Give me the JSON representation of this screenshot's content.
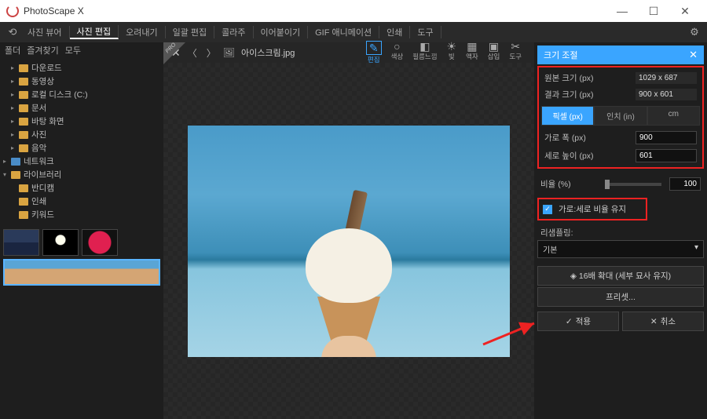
{
  "app": {
    "title": "PhotoScape X"
  },
  "window": {
    "min": "—",
    "max": "☐",
    "close": "✕"
  },
  "toolbar": {
    "items": [
      "사진 뷰어",
      "사진 편집",
      "오려내기",
      "일괄 편집",
      "콜라주",
      "이어붙이기",
      "GIF 애니메이션",
      "인쇄",
      "도구"
    ],
    "active_index": 1
  },
  "sidebar": {
    "tabs": [
      "폴더",
      "즐겨찾기",
      "모두"
    ],
    "tree": [
      {
        "label": "다운로드",
        "level": 1,
        "arrow": "▸",
        "color": "yellow"
      },
      {
        "label": "동영상",
        "level": 1,
        "arrow": "▸",
        "color": "yellow"
      },
      {
        "label": "로컬 디스크 (C:)",
        "level": 1,
        "arrow": "▸",
        "color": "yellow"
      },
      {
        "label": "문서",
        "level": 1,
        "arrow": "▸",
        "color": "yellow"
      },
      {
        "label": "바탕 화면",
        "level": 1,
        "arrow": "▸",
        "color": "yellow"
      },
      {
        "label": "사진",
        "level": 1,
        "arrow": "▸",
        "color": "yellow"
      },
      {
        "label": "음악",
        "level": 1,
        "arrow": "▸",
        "color": "yellow"
      },
      {
        "label": "네트워크",
        "level": 0,
        "arrow": "▸",
        "color": "blue"
      },
      {
        "label": "라이브러리",
        "level": 0,
        "arrow": "▾",
        "color": "yellow"
      },
      {
        "label": "반디캠",
        "level": 1,
        "arrow": "",
        "color": "yellow"
      },
      {
        "label": "인쇄",
        "level": 1,
        "arrow": "",
        "color": "yellow"
      },
      {
        "label": "키워드",
        "level": 1,
        "arrow": "",
        "color": "yellow"
      }
    ]
  },
  "canvas": {
    "filename": "아이스크림.jpg",
    "tools": [
      {
        "icon": "✎",
        "label": "편집"
      },
      {
        "icon": "○",
        "label": "색상"
      },
      {
        "icon": "◧",
        "label": "필름느낌"
      },
      {
        "icon": "☀",
        "label": "빛"
      },
      {
        "icon": "▦",
        "label": "액자"
      },
      {
        "icon": "▣",
        "label": "삽입"
      },
      {
        "icon": "✂",
        "label": "도구"
      }
    ],
    "active_tool": 0
  },
  "resize": {
    "title": "크기 조절",
    "orig_label": "원본 크기 (px)",
    "orig_value": "1029 x 687",
    "result_label": "결과 크기 (px)",
    "result_value": "900 x 601",
    "units": {
      "px": "픽셀 (px)",
      "in": "인치 (in)",
      "cm": "cm"
    },
    "active_unit": "px",
    "width_label": "가로 폭 (px)",
    "width_value": "900",
    "height_label": "세로 높이 (px)",
    "height_value": "601",
    "ratio_label": "비율 (%)",
    "ratio_value": "100",
    "aspect_label": "가로:세로 비율 유지",
    "aspect_checked": true,
    "resample_label": "리샘플링:",
    "resample_value": "기본",
    "zoom16_label": "16배 확대 (세부 묘사 유지)",
    "preset_label": "프리셋...",
    "apply_label": "적용",
    "cancel_label": "취소"
  }
}
